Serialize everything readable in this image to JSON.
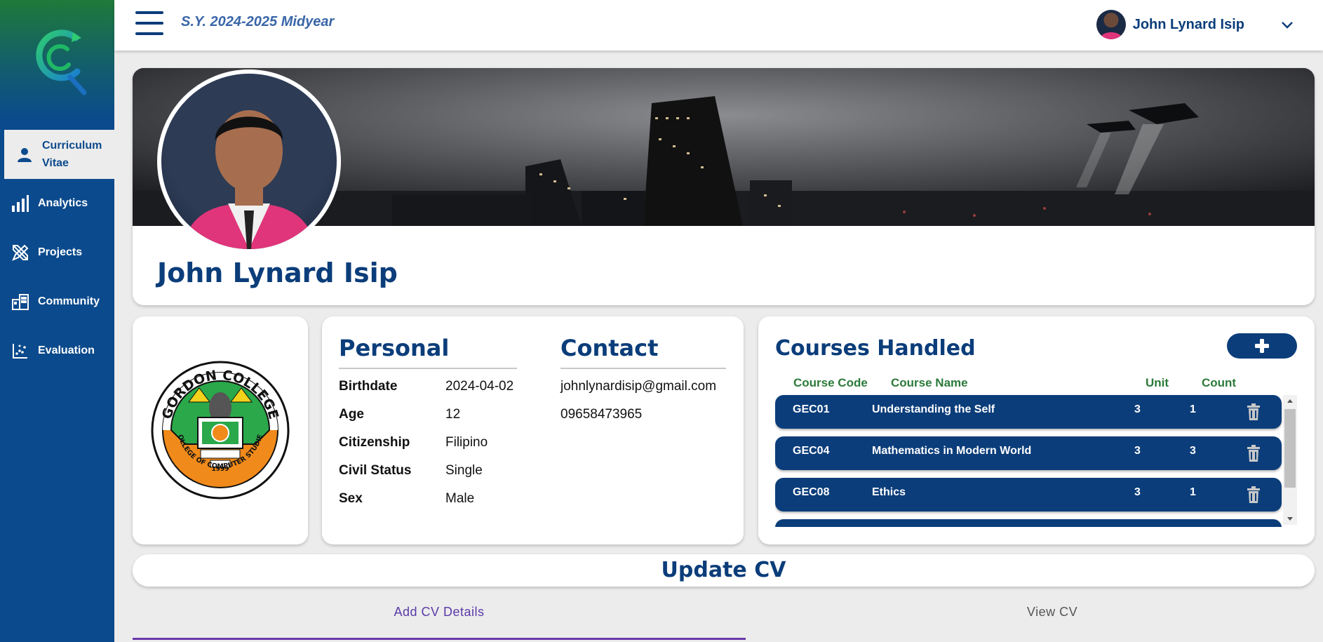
{
  "topbar": {
    "school_year": "S.Y. 2024-2025 Midyear",
    "user_name": "John Lynard Isip"
  },
  "sidebar": {
    "items": [
      {
        "label": "Curriculum Vitae",
        "icon": "person-icon",
        "active": true
      },
      {
        "label": "Analytics",
        "icon": "bar-chart-icon",
        "active": false
      },
      {
        "label": "Projects",
        "icon": "pencil-ruler-icon",
        "active": false
      },
      {
        "label": "Community",
        "icon": "buildings-icon",
        "active": false
      },
      {
        "label": "Evaluation",
        "icon": "scatter-chart-icon",
        "active": false
      }
    ]
  },
  "profile": {
    "name": "John Lynard Isip"
  },
  "logo_card": {
    "seal_top": "GORDON COLLEGE",
    "seal_bottom": "COLLEGE OF COMPUTER STUDIES",
    "seal_year": "1999"
  },
  "personal": {
    "title": "Personal",
    "fields": [
      {
        "label": "Birthdate",
        "value": "2024-04-02"
      },
      {
        "label": "Age",
        "value": "12"
      },
      {
        "label": "Citizenship",
        "value": "Filipino"
      },
      {
        "label": "Civil Status",
        "value": "Single"
      },
      {
        "label": "Sex",
        "value": "Male"
      }
    ]
  },
  "contact": {
    "title": "Contact",
    "email": "johnlynardisip@gmail.com",
    "phone": "09658473965"
  },
  "courses": {
    "title": "Courses Handled",
    "headers": {
      "code": "Course Code",
      "name": "Course Name",
      "unit": "Unit",
      "count": "Count"
    },
    "rows": [
      {
        "code": "GEC01",
        "name": "Understanding the Self",
        "unit": "3",
        "count": "1"
      },
      {
        "code": "GEC04",
        "name": "Mathematics in Modern World",
        "unit": "3",
        "count": "3"
      },
      {
        "code": "GEC08",
        "name": "Ethics",
        "unit": "3",
        "count": "1"
      }
    ]
  },
  "update_cv": {
    "title": "Update CV",
    "tabs": [
      "Add CV Details",
      "View CV"
    ]
  },
  "colors": {
    "primary": "#0b3d7a",
    "accent_green": "#2c7a3a",
    "tab_active": "#5a3aa8"
  }
}
